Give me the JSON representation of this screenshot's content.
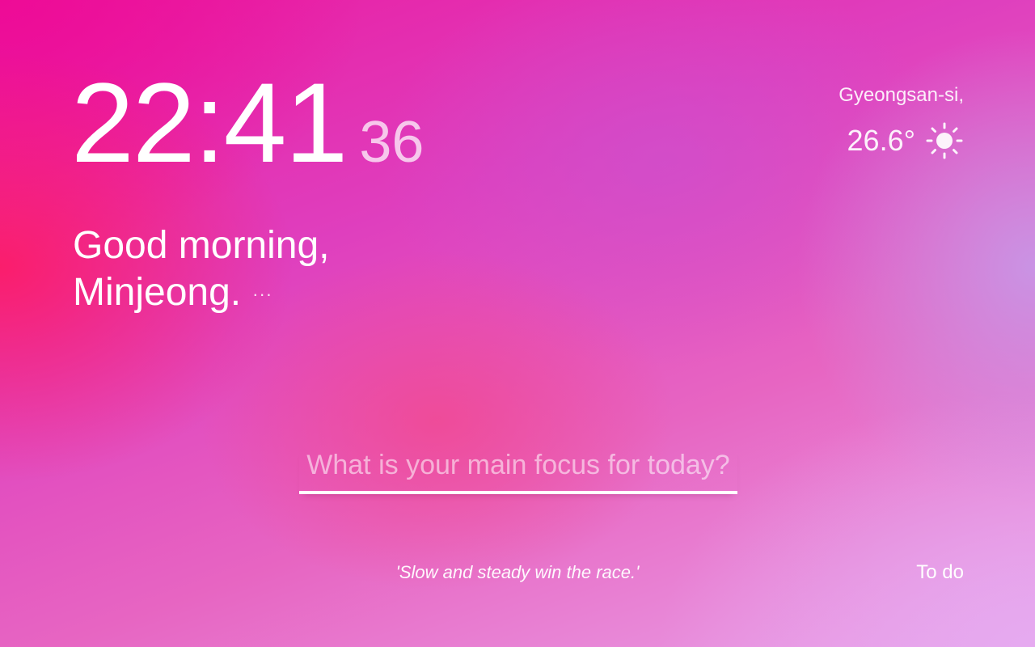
{
  "clock": {
    "time": "22:41",
    "seconds": "36"
  },
  "greeting": {
    "line1": "Good morning,",
    "line2": "Minjeong.",
    "more_label": "···"
  },
  "weather": {
    "location": "Gyeongsan-si,",
    "temperature": "26.6°",
    "icon": "sun-icon"
  },
  "focus": {
    "placeholder": "What is your main focus for today?",
    "value": ""
  },
  "quote": {
    "text": "'Slow and steady win the race.'"
  },
  "todo": {
    "label": "To do"
  }
}
